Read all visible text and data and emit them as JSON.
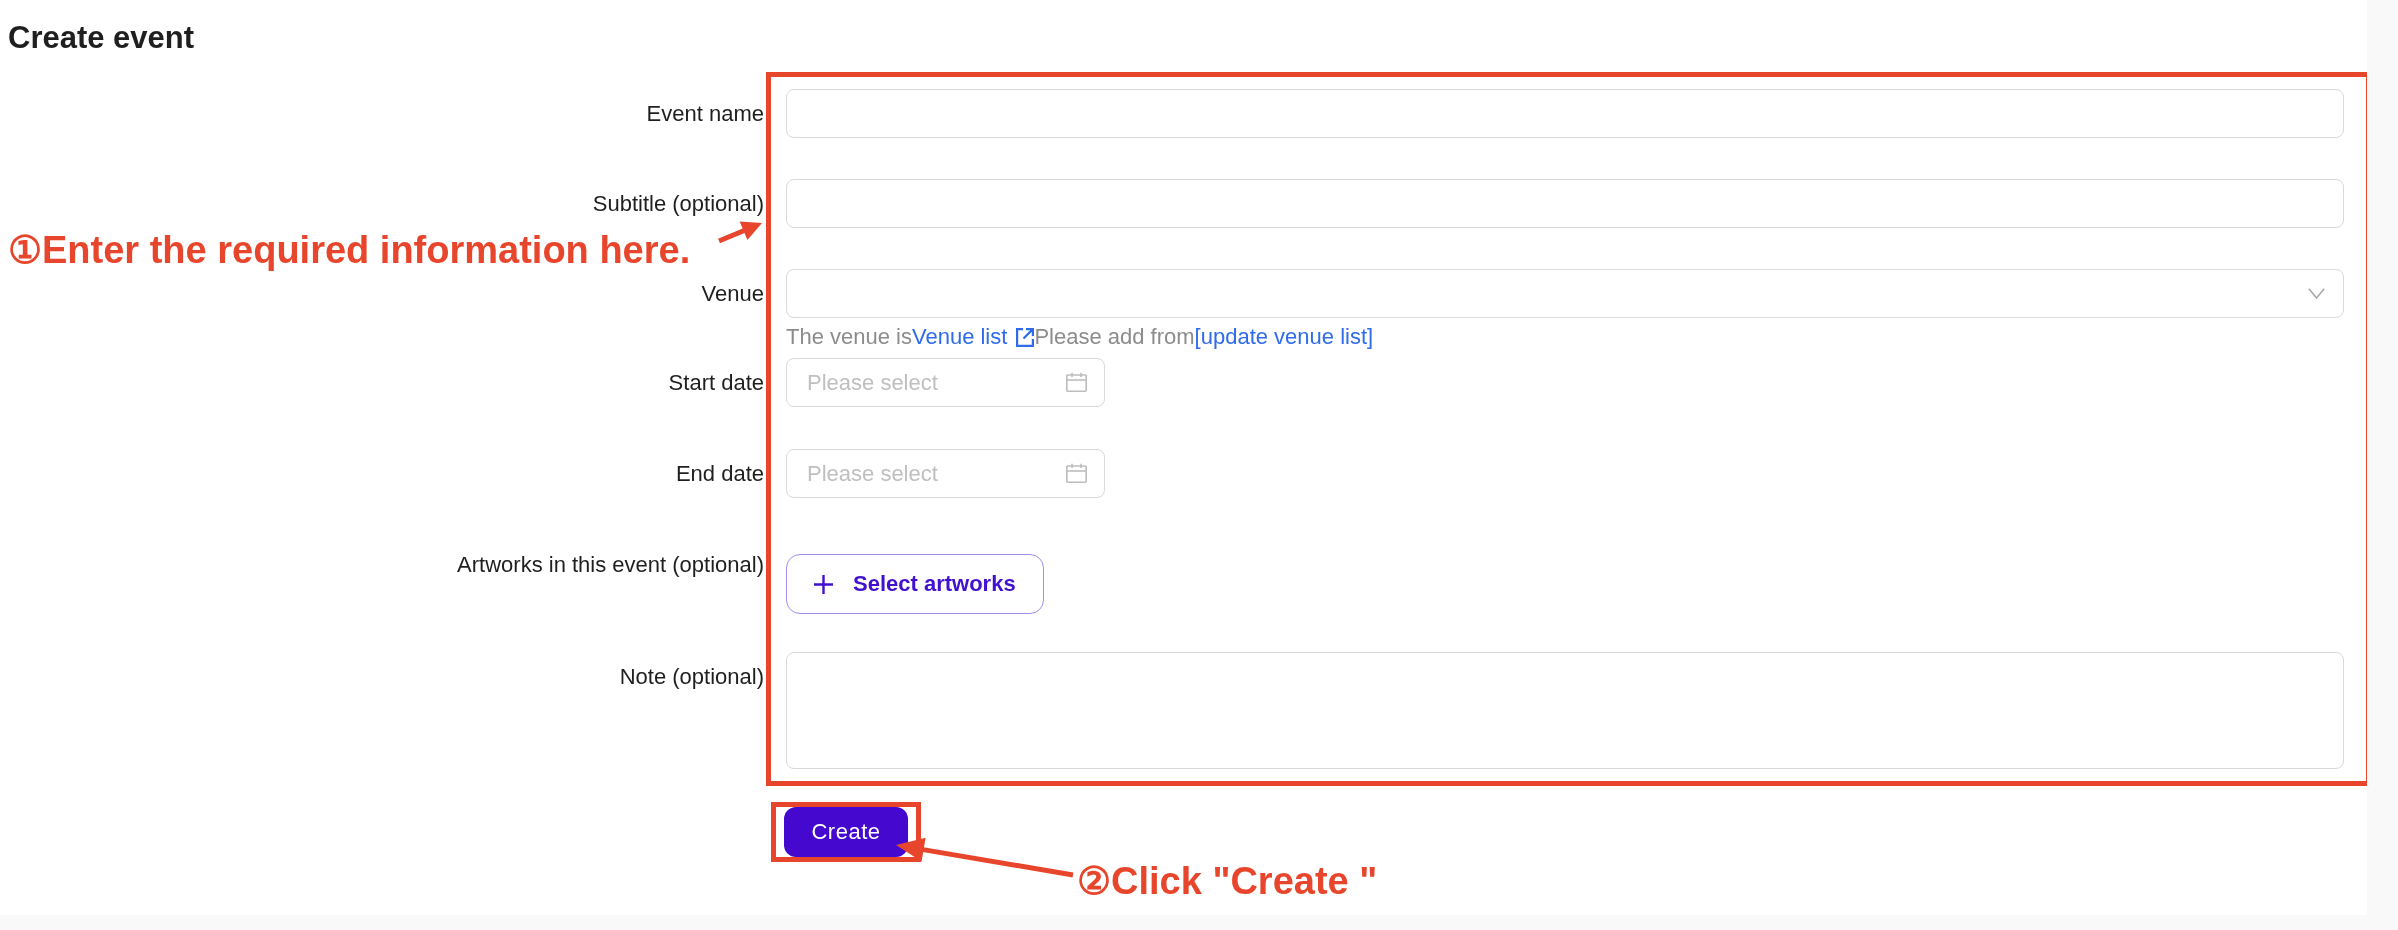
{
  "page": {
    "title": "Create event"
  },
  "form": {
    "highlighted": true,
    "fields": [
      {
        "label": "Event name",
        "kind": "text"
      },
      {
        "label": "Subtitle (optional)",
        "kind": "text"
      },
      {
        "label": "Venue",
        "kind": "select",
        "help": [
          {
            "kind": "text",
            "text": "The venue is"
          },
          {
            "kind": "link",
            "text": "Venue list",
            "external": true
          },
          {
            "kind": "text",
            "text": "Please add from"
          },
          {
            "kind": "link",
            "text": "[update venue list]",
            "external": false
          }
        ]
      },
      {
        "label": "Start date",
        "kind": "date",
        "placeholder": "Please select"
      },
      {
        "label": "End date",
        "kind": "date",
        "placeholder": "Please select"
      },
      {
        "label": "Artworks in this event (optional)",
        "kind": "button",
        "button_label": "Select artworks"
      },
      {
        "label": "Note (optional)",
        "kind": "textarea"
      }
    ],
    "submit": {
      "label": "Create",
      "highlighted": true
    }
  },
  "annotations": [
    {
      "text": "①Enter the required information here."
    },
    {
      "text": "②Click \"Create \""
    }
  ]
}
